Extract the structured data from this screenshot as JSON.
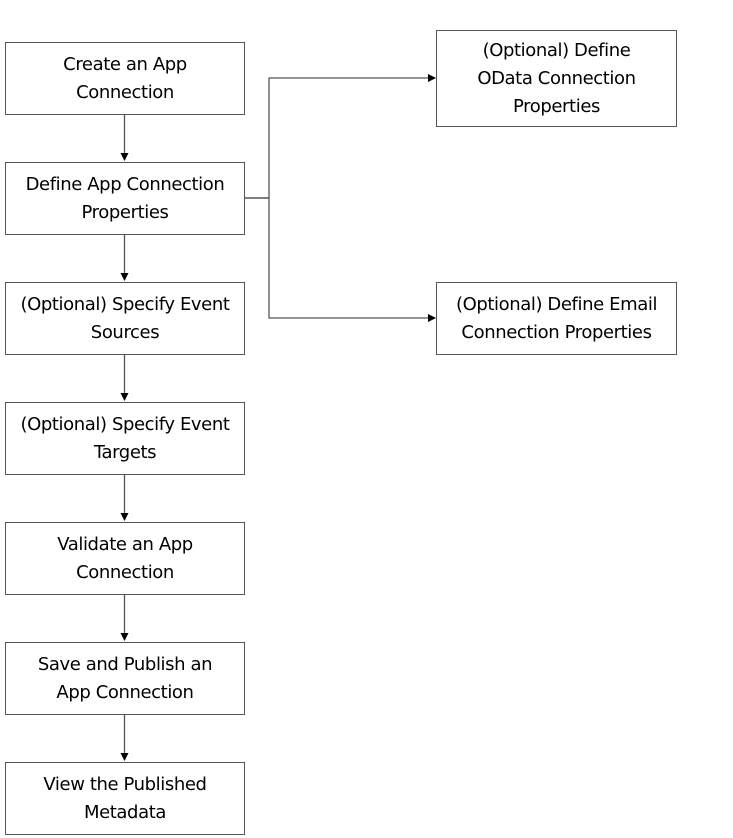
{
  "diagram": {
    "type": "flowchart",
    "nodes": [
      {
        "id": "create",
        "label": "Create an App\nConnection"
      },
      {
        "id": "define",
        "label": "Define App Connection\nProperties"
      },
      {
        "id": "sources",
        "label": "(Optional) Specify Event\nSources"
      },
      {
        "id": "targets",
        "label": "(Optional) Specify Event\nTargets"
      },
      {
        "id": "validate",
        "label": "Validate an App\nConnection"
      },
      {
        "id": "publish",
        "label": "Save and Publish an\nApp Connection"
      },
      {
        "id": "view",
        "label": "View the Published\nMetadata"
      },
      {
        "id": "odata",
        "label": "(Optional) Define\nOData Connection\nProperties"
      },
      {
        "id": "email",
        "label": "(Optional) Define Email\nConnection Properties"
      }
    ],
    "edges": [
      {
        "from": "create",
        "to": "define"
      },
      {
        "from": "define",
        "to": "sources"
      },
      {
        "from": "sources",
        "to": "targets"
      },
      {
        "from": "targets",
        "to": "validate"
      },
      {
        "from": "validate",
        "to": "publish"
      },
      {
        "from": "publish",
        "to": "view"
      },
      {
        "from": "define",
        "to": "odata"
      },
      {
        "from": "define",
        "to": "email"
      }
    ],
    "colors": {
      "border": "#555555",
      "line": "#555555",
      "arrow": "#000000",
      "text": "#000000",
      "background": "#ffffff"
    }
  }
}
